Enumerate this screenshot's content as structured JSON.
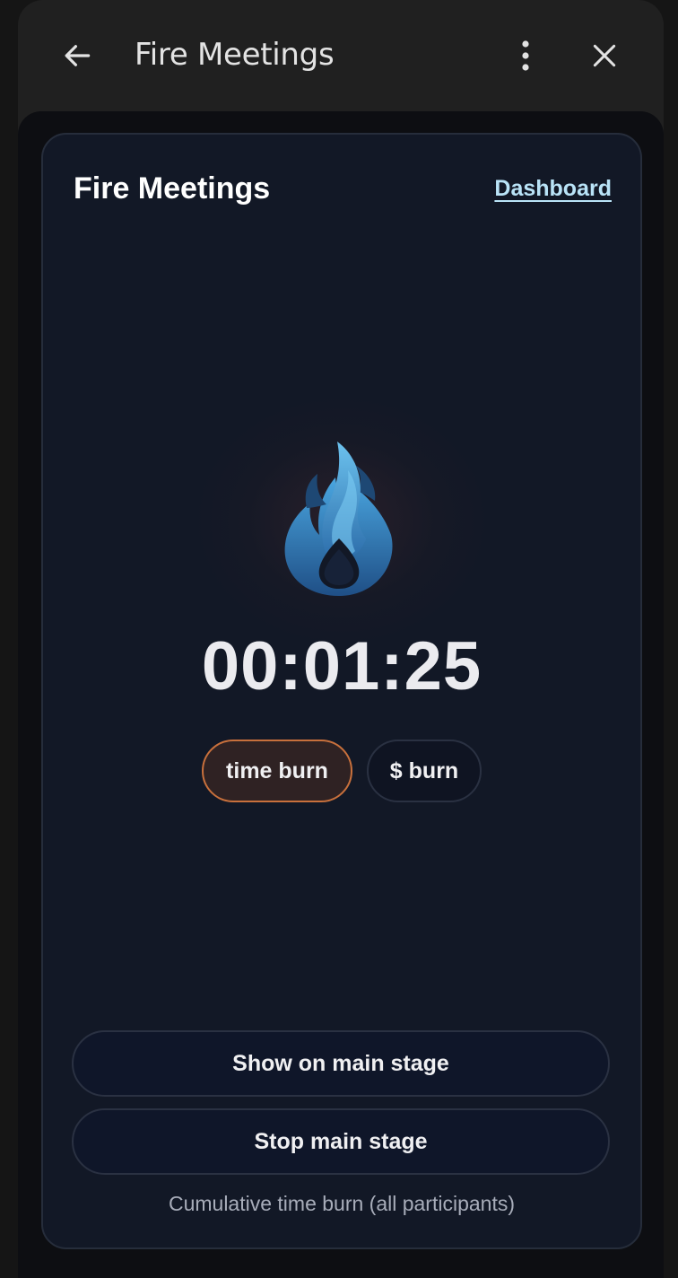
{
  "header": {
    "title": "Fire Meetings",
    "back_icon": "arrow-left-icon",
    "more_icon": "more-vertical-icon",
    "close_icon": "close-icon"
  },
  "card": {
    "title": "Fire Meetings",
    "dashboard_link": "Dashboard",
    "flame_icon": "flame-icon",
    "timer": "00:01:25",
    "toggles": [
      {
        "label": "time burn",
        "active": true
      },
      {
        "label": "$ burn",
        "active": false
      }
    ],
    "show_main_stage": "Show on main stage",
    "stop_main_stage": "Stop main stage",
    "footnote": "Cumulative time burn (all participants)"
  },
  "colors": {
    "accent_active_border": "#c8703c",
    "link": "#b9e3f7",
    "card_bg": "#121826",
    "flame_blue": "#3a8fd0"
  }
}
